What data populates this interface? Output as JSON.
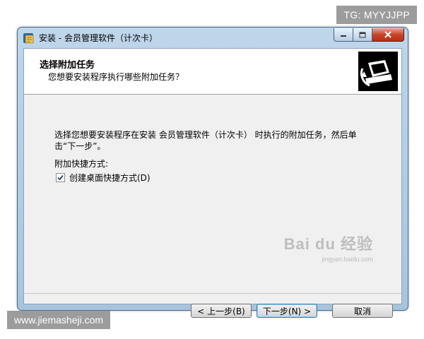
{
  "overlay": {
    "tg_badge": "TG: MYYJJPP",
    "url_badge": "www.jiemasheji.com",
    "watermark": "Bai du 经验",
    "watermark_sub": "jingyan.baidu.com"
  },
  "window": {
    "title": "安装 - 会员管理软件（计次卡）",
    "controls": [
      "minimize",
      "maximize",
      "close"
    ]
  },
  "header": {
    "title": "选择附加任务",
    "subtitle": "您想要安装程序执行哪些附加任务？"
  },
  "body": {
    "description": "选择您想要安装程序在安装 会员管理软件（计次卡） 时执行的附加任务，然后单击“下一步”。",
    "group_label": "附加快捷方式:",
    "checkbox_label": "创建桌面快捷方式(D)",
    "checkbox_checked": true
  },
  "buttons": {
    "back": "< 上一步(B)",
    "next": "下一步(N) >",
    "cancel": "取消"
  },
  "colors": {
    "accent_default_button": "#3c7fb1",
    "close_button": "#c8452b",
    "title_bar": "#bfd6ea"
  }
}
